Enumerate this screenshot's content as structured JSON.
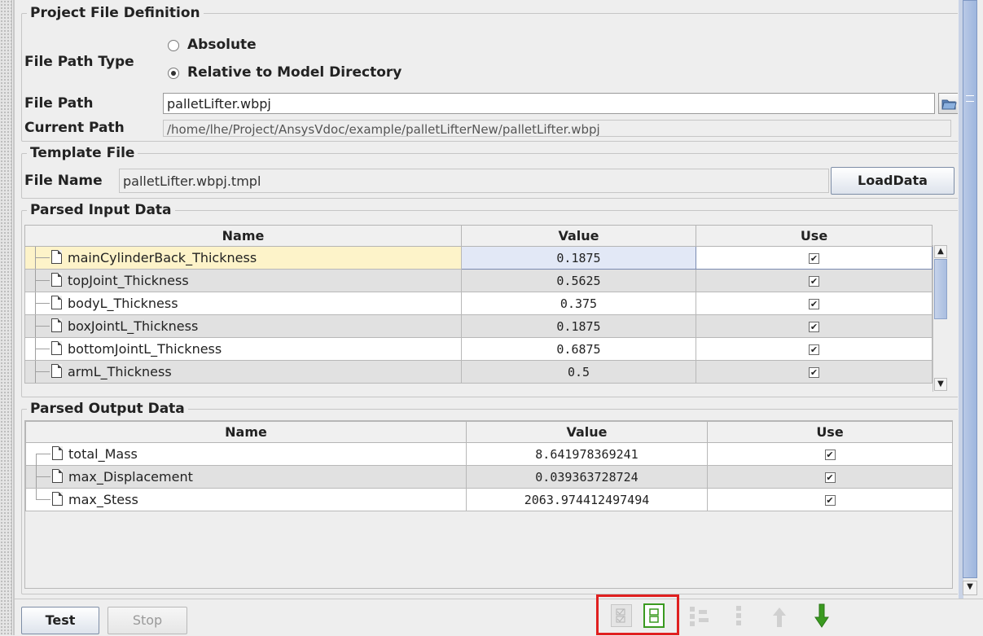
{
  "project": {
    "legend": "Project File Definition",
    "file_path_type_label": "File Path Type",
    "radio_absolute": "Absolute",
    "radio_relative": "Relative to Model Directory",
    "selected": "Relative to Model Directory",
    "file_path_label": "File Path",
    "file_path_value": "palletLifter.wbpj",
    "current_path_label": "Current Path",
    "current_path_value": "/home/lhe/Project/AnsysVdoc/example/palletLifterNew/palletLifter.wbpj"
  },
  "template": {
    "legend": "Template File",
    "file_name_label": "File Name",
    "file_name_value": "palletLifter.wbpj.tmpl",
    "load_button": "LoadData"
  },
  "input_table": {
    "legend": "Parsed Input Data",
    "columns": [
      "Name",
      "Value",
      "Use"
    ],
    "rows": [
      {
        "name": "mainCylinderBack_Thickness",
        "value": "0.1875",
        "use": true
      },
      {
        "name": "topJoint_Thickness",
        "value": "0.5625",
        "use": true
      },
      {
        "name": "bodyL_Thickness",
        "value": "0.375",
        "use": true
      },
      {
        "name": "boxJointL_Thickness",
        "value": "0.1875",
        "use": true
      },
      {
        "name": "bottomJointL_Thickness",
        "value": "0.6875",
        "use": true
      },
      {
        "name": "armL_Thickness",
        "value": "0.5",
        "use": true
      }
    ]
  },
  "output_table": {
    "legend": "Parsed Output Data",
    "columns": [
      "Name",
      "Value",
      "Use"
    ],
    "rows": [
      {
        "name": "total_Mass",
        "value": "8.641978369241",
        "use": true
      },
      {
        "name": "max_Displacement",
        "value": "0.039363728724",
        "use": true
      },
      {
        "name": "max_Stess",
        "value": "2063.974412497494",
        "use": true
      }
    ]
  },
  "bottom": {
    "test_button": "Test",
    "stop_button": "Stop"
  },
  "colors": {
    "selected_row": "#fdf3c9",
    "highlight_box": "#e02020",
    "green_icon": "#3a9a20"
  }
}
